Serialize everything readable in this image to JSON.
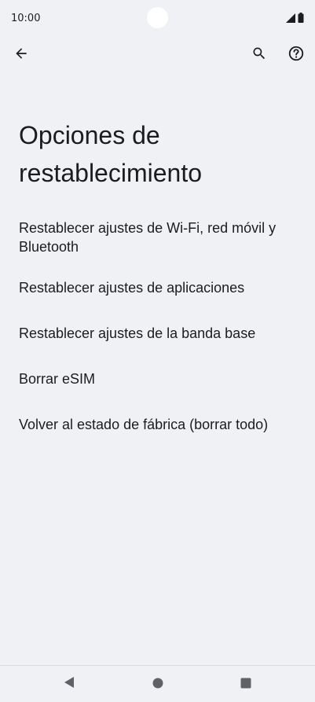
{
  "status_bar": {
    "time": "10:00"
  },
  "app_bar": {
    "back_icon": "arrow-back-icon",
    "search_icon": "search-icon",
    "help_icon": "help-icon"
  },
  "page": {
    "title": "Opciones de restablecimiento"
  },
  "options": [
    {
      "label": "Restablecer ajustes de Wi-Fi, red móvil y Bluetooth"
    },
    {
      "label": "Restablecer ajustes de aplicaciones"
    },
    {
      "label": "Restablecer ajustes de la banda base"
    },
    {
      "label": "Borrar eSIM"
    },
    {
      "label": "Volver al estado de fábrica (borrar todo)"
    }
  ],
  "nav_bar": {
    "back_icon": "triangle-back-icon",
    "home_icon": "circle-home-icon",
    "recents_icon": "square-recents-icon"
  },
  "colors": {
    "background": "#f0f1f5",
    "text": "#1b1c20",
    "nav_icon": "#5f6166"
  }
}
